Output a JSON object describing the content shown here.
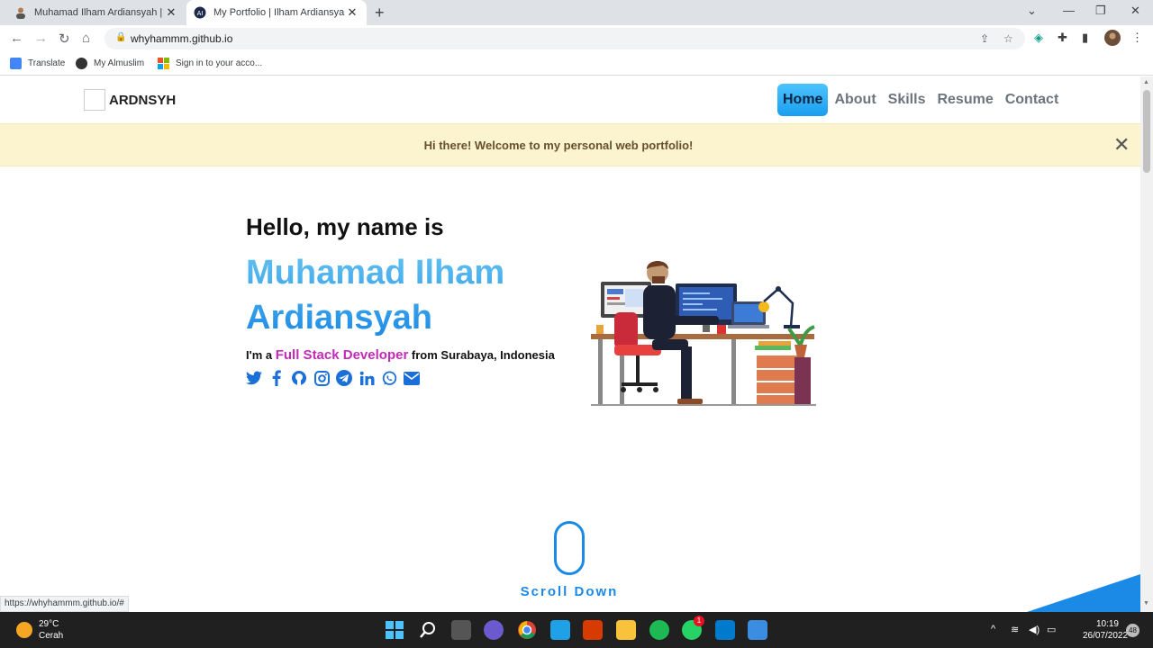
{
  "browser": {
    "tabs": [
      {
        "title": "Muhamad Ilham Ardiansyah | Portfolio",
        "active": false
      },
      {
        "title": "My Portfolio | Ilham Ardiansyah",
        "active": true
      }
    ],
    "new_tab_icon": "+",
    "url": "whyhammm.github.io",
    "bookmarks": [
      {
        "label": "Translate",
        "icon": "translate-icon"
      },
      {
        "label": "My Almuslim",
        "icon": "globe-icon"
      },
      {
        "label": "Sign in to your acco...",
        "icon": "microsoft-icon"
      }
    ],
    "status_link": "https://whyhammm.github.io/#"
  },
  "page": {
    "brand": "ARDNSYH",
    "nav": [
      {
        "label": "Home",
        "active": true
      },
      {
        "label": "About",
        "active": false
      },
      {
        "label": "Skills",
        "active": false
      },
      {
        "label": "Resume",
        "active": false
      },
      {
        "label": "Contact",
        "active": false
      }
    ],
    "alert": "Hi there! Welcome to my personal web portfolio!",
    "hero": {
      "greeting": "Hello, my name is",
      "name": "Muhamad Ilham Ardiansyah",
      "tag_prefix": "I'm a",
      "role": "Full Stack Developer",
      "tag_suffix": "from Surabaya, Indonesia"
    },
    "socials": [
      "twitter-icon",
      "facebook-icon",
      "github-icon",
      "instagram-icon",
      "telegram-icon",
      "linkedin-icon",
      "whatsapp-icon",
      "email-icon"
    ],
    "scroll_label": "Scroll Down"
  },
  "taskbar": {
    "temp": "29°C",
    "weather": "Cerah",
    "time": "10:19",
    "date": "26/07/2022",
    "notifications": "48",
    "whatsapp_badge": "1"
  },
  "colors": {
    "accent": "#1b8ae6",
    "role": "#c42ab9",
    "alert_bg": "#fcf3cf"
  }
}
